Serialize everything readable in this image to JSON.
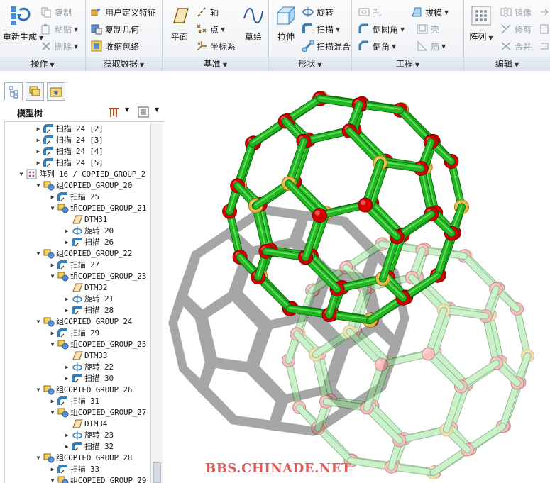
{
  "ribbon": {
    "operations": {
      "label": "操作",
      "regenerate": "重新生成",
      "copy": "复制",
      "paste": "粘贴",
      "delete": "删除"
    },
    "get_data": {
      "label": "获取数据",
      "udf": "用户定义特征",
      "copy_geometry": "复制几何",
      "shrinkwrap": "收缩包络"
    },
    "datum": {
      "label": "基准",
      "plane": "平面",
      "axis": "轴",
      "point": "点",
      "csys": "坐标系",
      "sketch": "草绘"
    },
    "shapes": {
      "label": "形状",
      "extrude": "拉伸",
      "revolve": "旋转",
      "sweep": "扫描",
      "swept_blend": "扫描混合"
    },
    "engineering": {
      "label": "工程",
      "hole": "孔",
      "draft": "拔模",
      "round": "倒圆角",
      "shell": "壳",
      "chamfer": "倒角",
      "rib": "筋"
    },
    "pattern": {
      "label": "阵列"
    },
    "editing": {
      "label": "编辑",
      "mirror": "镜像",
      "trim": "修剪",
      "merge": "合并"
    }
  },
  "model_tree": {
    "title": "模型树",
    "nodes": [
      {
        "label": "扫描 24 [2]",
        "icon": "sweep-icon",
        "level": 2,
        "toggle": "collapsed"
      },
      {
        "label": "扫描 24 [3]",
        "icon": "sweep-icon",
        "level": 2,
        "toggle": "collapsed"
      },
      {
        "label": "扫描 24 [4]",
        "icon": "sweep-icon",
        "level": 2,
        "toggle": "collapsed"
      },
      {
        "label": "扫描 24 [5]",
        "icon": "sweep-icon",
        "level": 2,
        "toggle": "collapsed"
      },
      {
        "label": "阵列 16 / COPIED_GROUP_2",
        "icon": "pattern-icon",
        "level": 1,
        "toggle": "expanded"
      },
      {
        "label": "组COPIED_GROUP_20",
        "icon": "group-icon",
        "level": 2,
        "toggle": "expanded"
      },
      {
        "label": "扫描 25",
        "icon": "sweep-icon",
        "level": 3,
        "toggle": "collapsed"
      },
      {
        "label": "组COPIED_GROUP_21",
        "icon": "group-icon",
        "level": 3,
        "toggle": "expanded"
      },
      {
        "label": "DTM31",
        "icon": "datum-plane-icon",
        "level": 4,
        "toggle": "none"
      },
      {
        "label": "旋转 20",
        "icon": "revolve-icon",
        "level": 4,
        "toggle": "collapsed"
      },
      {
        "label": "扫描 26",
        "icon": "sweep-icon",
        "level": 4,
        "toggle": "collapsed"
      },
      {
        "label": "组COPIED_GROUP_22",
        "icon": "group-icon",
        "level": 2,
        "toggle": "expanded"
      },
      {
        "label": "扫描 27",
        "icon": "sweep-icon",
        "level": 3,
        "toggle": "collapsed"
      },
      {
        "label": "组COPIED_GROUP_23",
        "icon": "group-icon",
        "level": 3,
        "toggle": "expanded"
      },
      {
        "label": "DTM32",
        "icon": "datum-plane-icon",
        "level": 4,
        "toggle": "none"
      },
      {
        "label": "旋转 21",
        "icon": "revolve-icon",
        "level": 4,
        "toggle": "collapsed"
      },
      {
        "label": "扫描 28",
        "icon": "sweep-icon",
        "level": 4,
        "toggle": "collapsed"
      },
      {
        "label": "组COPIED_GROUP_24",
        "icon": "group-icon",
        "level": 2,
        "toggle": "expanded"
      },
      {
        "label": "扫描 29",
        "icon": "sweep-icon",
        "level": 3,
        "toggle": "collapsed"
      },
      {
        "label": "组COPIED_GROUP_25",
        "icon": "group-icon",
        "level": 3,
        "toggle": "expanded"
      },
      {
        "label": "DTM33",
        "icon": "datum-plane-icon",
        "level": 4,
        "toggle": "none"
      },
      {
        "label": "旋转 22",
        "icon": "revolve-icon",
        "level": 4,
        "toggle": "collapsed"
      },
      {
        "label": "扫描 30",
        "icon": "sweep-icon",
        "level": 4,
        "toggle": "collapsed"
      },
      {
        "label": "组COPIED_GROUP_26",
        "icon": "group-icon",
        "level": 2,
        "toggle": "expanded"
      },
      {
        "label": "扫描 31",
        "icon": "sweep-icon",
        "level": 3,
        "toggle": "collapsed"
      },
      {
        "label": "组COPIED_GROUP_27",
        "icon": "group-icon",
        "level": 3,
        "toggle": "expanded"
      },
      {
        "label": "DTM34",
        "icon": "datum-plane-icon",
        "level": 4,
        "toggle": "none"
      },
      {
        "label": "旋转 23",
        "icon": "revolve-icon",
        "level": 4,
        "toggle": "collapsed"
      },
      {
        "label": "扫描 32",
        "icon": "sweep-icon",
        "level": 4,
        "toggle": "collapsed"
      },
      {
        "label": "组COPIED_GROUP_28",
        "icon": "group-icon",
        "level": 2,
        "toggle": "expanded"
      },
      {
        "label": "扫描 33",
        "icon": "sweep-icon",
        "level": 3,
        "toggle": "collapsed"
      },
      {
        "label": "组COPIED_GROUP_29",
        "icon": "group-icon",
        "level": 3,
        "toggle": "expanded"
      }
    ]
  },
  "viewport": {
    "watermark": "BBS.CHINADE.NET",
    "colors": {
      "strut": "#22b622",
      "node": "#d40000",
      "accent_node": "#e8b84a",
      "ghost_strut": "#8fdc8f",
      "ghost_node": "#f07070",
      "shadow": "#777777",
      "watermark": "#e05a5a"
    }
  },
  "colors": {
    "ribbon_bg": "#f4f6f9",
    "group_label_bg": "#dfe6ee",
    "tree_line": "#c9d1db"
  }
}
